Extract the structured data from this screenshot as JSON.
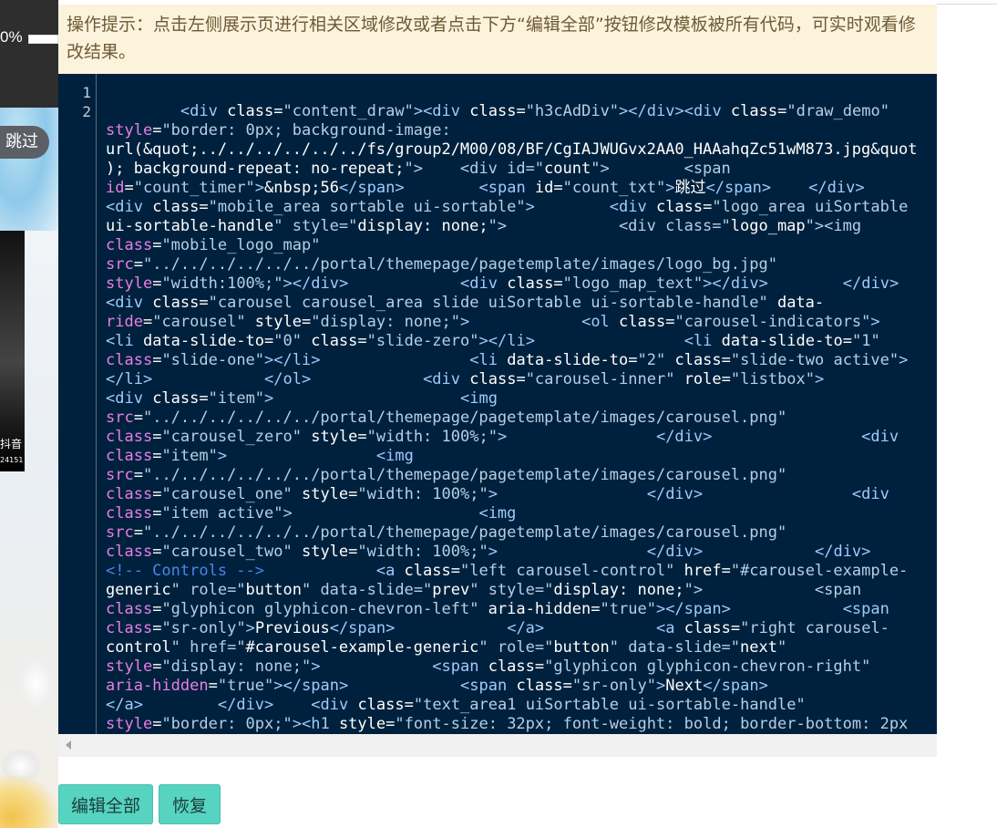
{
  "preview": {
    "progress_text": "0%",
    "skip_label": "跳过",
    "video_caption": "抖音",
    "video_id": "24151"
  },
  "tip": {
    "text": "操作提示：点击左侧展示页进行相关区域修改或者点击下方“编辑全部”按钮修改模板被所有代码，可实时观看修改结果。"
  },
  "editor": {
    "line_numbers": [
      "1",
      "2"
    ],
    "code_lines": [
      "",
      "        <div class=\"content_draw\"><div class=\"h3cAdDiv\"></div><div class=\"draw_demo\"",
      "style=\"border: 0px; background-image:",
      "url(&quot;../../../../../../fs/group2/M00/08/BF/CgIAJWUGvx2AA0_HAAahqZc51wM873.jpg&quot",
      "); background-repeat: no-repeat;\">    <div id=\"count\">        <span",
      "id=\"count_timer\">&nbsp;56</span>        <span id=\"count_txt\">跳过</span>    </div>",
      "<div class=\"mobile_area sortable ui-sortable\">        <div class=\"logo_area uiSortable",
      "ui-sortable-handle\" style=\"display: none;\">            <div class=\"logo_map\"><img",
      "class=\"mobile_logo_map\"",
      "src=\"../../../../../../portal/themepage/pagetemplate/images/logo_bg.jpg\"",
      "style=\"width:100%;\"></div>            <div class=\"logo_map_text\"></div>        </div>",
      "<div class=\"carousel carousel_area slide uiSortable ui-sortable-handle\" data-",
      "ride=\"carousel\" style=\"display: none;\">            <ol class=\"carousel-indicators\">",
      "<li data-slide-to=\"0\" class=\"slide-zero\"></li>                <li data-slide-to=\"1\"",
      "class=\"slide-one\"></li>                <li data-slide-to=\"2\" class=\"slide-two active\">",
      "</li>            </ol>            <div class=\"carousel-inner\" role=\"listbox\">",
      "<div class=\"item\">                    <img",
      "src=\"../../../../../../portal/themepage/pagetemplate/images/carousel.png\"",
      "class=\"carousel_zero\" style=\"width: 100%;\">                </div>                <div",
      "class=\"item\">                <img",
      "src=\"../../../../../../portal/themepage/pagetemplate/images/carousel.png\"",
      "class=\"carousel_one\" style=\"width: 100%;\">                </div>                <div",
      "class=\"item active\">                    <img",
      "src=\"../../../../../../portal/themepage/pagetemplate/images/carousel.png\"",
      "class=\"carousel_two\" style=\"width: 100%;\">                </div>            </div>",
      "<!-- Controls -->            <a class=\"left carousel-control\" href=\"#carousel-example-",
      "generic\" role=\"button\" data-slide=\"prev\" style=\"display: none;\">            <span",
      "class=\"glyphicon glyphicon-chevron-left\" aria-hidden=\"true\"></span>            <span",
      "class=\"sr-only\">Previous</span>            </a>            <a class=\"right carousel-",
      "control\" href=\"#carousel-example-generic\" role=\"button\" data-slide=\"next\"",
      "style=\"display: none;\">            <span class=\"glyphicon glyphicon-chevron-right\"",
      "aria-hidden=\"true\"></span>            <span class=\"sr-only\">Next</span>",
      "</a>        </div>    <div class=\"text_area1 uiSortable ui-sortable-handle\"",
      "style=\"border: 0px;\"><h1 style=\"font-size: 32px; font-weight: bold; border-bottom: 2px"
    ]
  },
  "buttons": {
    "edit_all": "编辑全部",
    "restore": "恢复"
  }
}
